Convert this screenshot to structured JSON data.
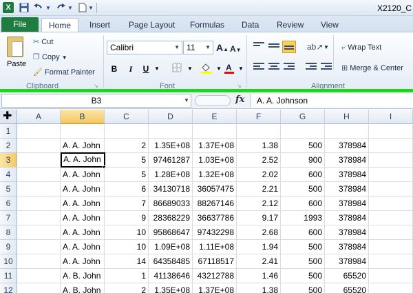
{
  "titlebar": {
    "window_title": "X2120_C",
    "app_icon": "X"
  },
  "tabs": {
    "file": "File",
    "items": [
      "Home",
      "Insert",
      "Page Layout",
      "Formulas",
      "Data",
      "Review",
      "View"
    ],
    "active": "Home"
  },
  "ribbon": {
    "clipboard": {
      "paste": "Paste",
      "cut": "Cut",
      "copy": "Copy",
      "format_painter": "Format Painter",
      "label": "Clipboard"
    },
    "font": {
      "name": "Calibri",
      "size": "11",
      "grow": "A",
      "shrink": "A",
      "bold": "B",
      "italic": "I",
      "underline": "U",
      "fill_color": "#ffff00",
      "font_color": "#ff0000",
      "label": "Font"
    },
    "alignment": {
      "wrap_text": "Wrap Text",
      "merge_center": "Merge & Center",
      "label": "Alignment"
    }
  },
  "formula_bar": {
    "name_box": "B3",
    "fx": "fx",
    "formula": "A. A. Johnson"
  },
  "sheet": {
    "columns": [
      "A",
      "B",
      "C",
      "D",
      "E",
      "F",
      "G",
      "H",
      "I"
    ],
    "selected_column": "B",
    "selected_row": 3,
    "active_cell": "B3",
    "rows": [
      {
        "num": "1",
        "cells": [
          "",
          "",
          "",
          "",
          "",
          "",
          "",
          "",
          ""
        ]
      },
      {
        "num": "2",
        "cells": [
          "",
          "A. A. John",
          "2",
          "1.35E+08",
          "1.37E+08",
          "1.38",
          "500",
          "378984",
          ""
        ]
      },
      {
        "num": "3",
        "cells": [
          "",
          "A. A. John",
          "5",
          "97461287",
          "1.03E+08",
          "2.52",
          "900",
          "378984",
          ""
        ]
      },
      {
        "num": "4",
        "cells": [
          "",
          "A. A. John",
          "5",
          "1.28E+08",
          "1.32E+08",
          "2.02",
          "600",
          "378984",
          ""
        ]
      },
      {
        "num": "5",
        "cells": [
          "",
          "A. A. John",
          "6",
          "34130718",
          "36057475",
          "2.21",
          "500",
          "378984",
          ""
        ]
      },
      {
        "num": "6",
        "cells": [
          "",
          "A. A. John",
          "7",
          "86689033",
          "88267146",
          "2.12",
          "600",
          "378984",
          ""
        ]
      },
      {
        "num": "7",
        "cells": [
          "",
          "A. A. John",
          "9",
          "28368229",
          "36637786",
          "9.17",
          "1993",
          "378984",
          ""
        ]
      },
      {
        "num": "8",
        "cells": [
          "",
          "A. A. John",
          "10",
          "95868647",
          "97432298",
          "2.68",
          "600",
          "378984",
          ""
        ]
      },
      {
        "num": "9",
        "cells": [
          "",
          "A. A. John",
          "10",
          "1.09E+08",
          "1.11E+08",
          "1.94",
          "500",
          "378984",
          ""
        ]
      },
      {
        "num": "10",
        "cells": [
          "",
          "A. A. John",
          "14",
          "64358485",
          "67118517",
          "2.41",
          "500",
          "378984",
          ""
        ]
      },
      {
        "num": "11",
        "cells": [
          "",
          "A. B. John",
          "1",
          "41138646",
          "43212788",
          "1.46",
          "500",
          "65520",
          ""
        ]
      },
      {
        "num": "12",
        "cells": [
          "",
          "A. B. John",
          "2",
          "1.35E+08",
          "1.37E+08",
          "1.38",
          "500",
          "65520",
          ""
        ]
      }
    ]
  }
}
